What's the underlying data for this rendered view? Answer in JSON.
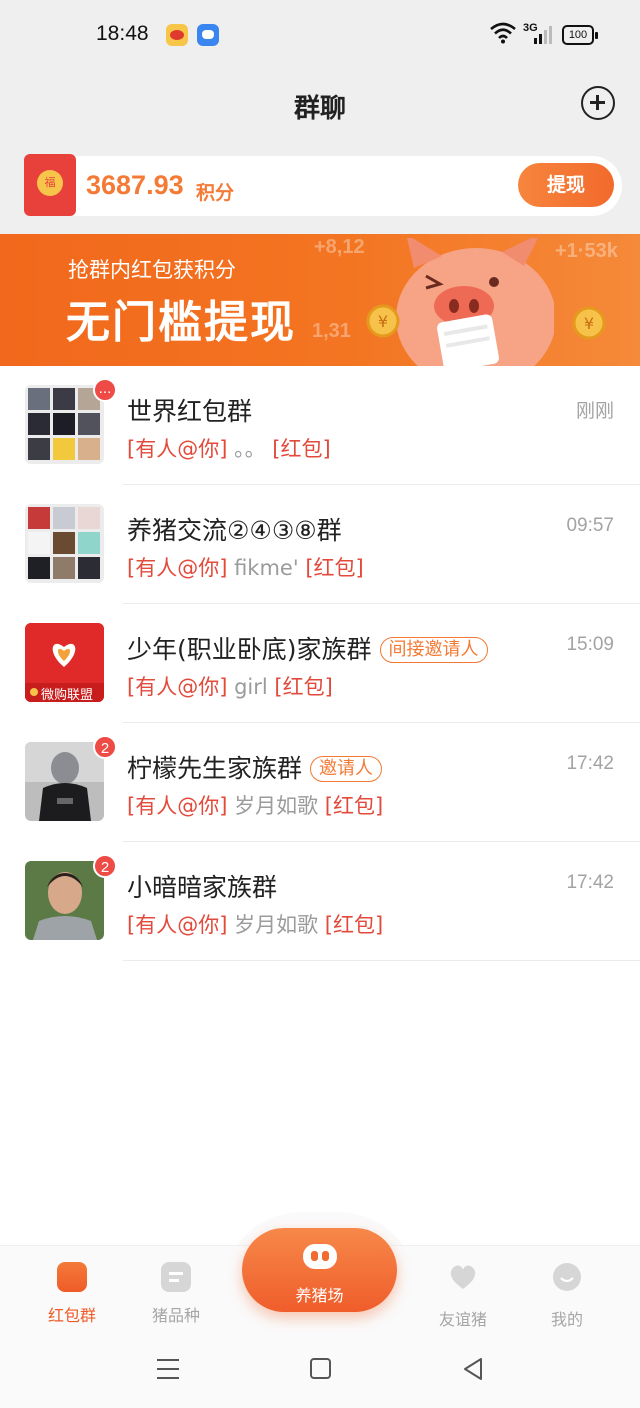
{
  "status_bar": {
    "time": "18:48",
    "network": "3G",
    "battery": "100"
  },
  "header": {
    "title": "群聊"
  },
  "points": {
    "value": "3687.93",
    "unit": "积分",
    "withdraw_label": "提现",
    "packet_glyph": "福"
  },
  "banner": {
    "subtitle": "抢群内红包获积分",
    "title": "无门槛提现",
    "deco_1": "+8,12",
    "deco_2": "+1·53k",
    "deco_3": "1,31"
  },
  "chats": [
    {
      "name": "世界红包群",
      "time": "刚刚",
      "mention": "[有人@你]",
      "preview": "。。",
      "red": "[红包]",
      "badge": "...",
      "role": ""
    },
    {
      "name": "养猪交流②④③⑧群",
      "time": "09:57",
      "mention": "[有人@你]",
      "preview": "fikme'",
      "red": "[红包]",
      "badge": "",
      "role": ""
    },
    {
      "name": "少年(职业卧底)家族群",
      "time": "15:09",
      "mention": "[有人@你]",
      "preview": "girl",
      "red": "[红包]",
      "badge": "",
      "role": "间接邀请人",
      "avatar_text": "微购联盟"
    },
    {
      "name": "柠檬先生家族群",
      "time": "17:42",
      "mention": "[有人@你]",
      "preview": "岁月如歌",
      "red": "[红包]",
      "badge": "2",
      "role": "邀请人"
    },
    {
      "name": "小暗暗家族群",
      "time": "17:42",
      "mention": "[有人@你]",
      "preview": "岁月如歌",
      "red": "[红包]",
      "badge": "2",
      "role": ""
    }
  ],
  "nav": {
    "items": [
      {
        "label": "红包群",
        "icon": "red-packet-icon"
      },
      {
        "label": "猪品种",
        "icon": "breed-card-icon"
      },
      {
        "label": "养猪场",
        "icon": "pig-nose-icon"
      },
      {
        "label": "友谊猪",
        "icon": "heart-icon"
      },
      {
        "label": "我的",
        "icon": "smile-icon"
      }
    ]
  },
  "colors": {
    "accent": "#f26a2c",
    "mention": "#e24a3b",
    "badge": "#ee4b46"
  }
}
